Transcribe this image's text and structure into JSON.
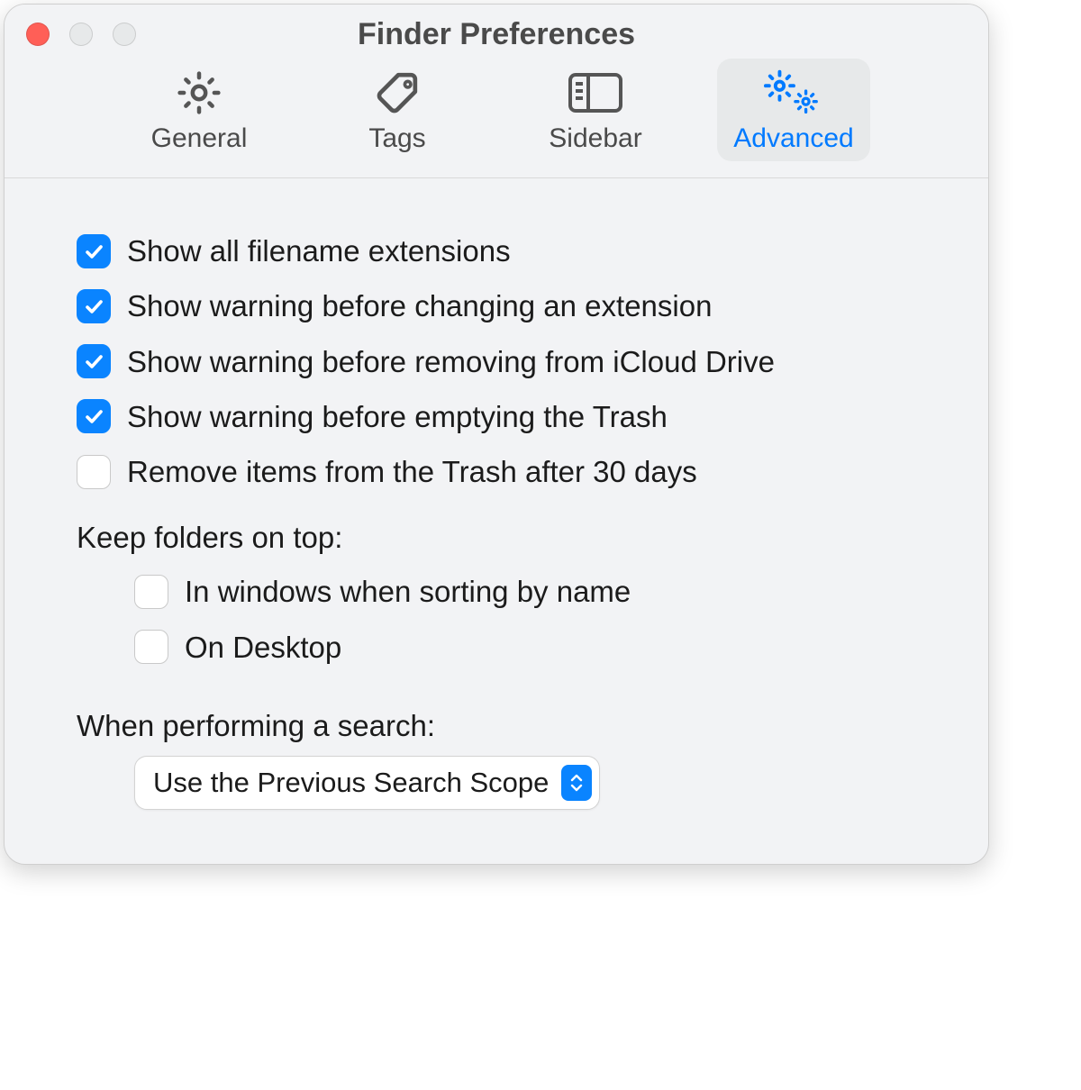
{
  "windowTitle": "Finder Preferences",
  "tabs": {
    "general": {
      "label": "General",
      "selected": false
    },
    "tags": {
      "label": "Tags",
      "selected": false
    },
    "sidebar": {
      "label": "Sidebar",
      "selected": false
    },
    "advanced": {
      "label": "Advanced",
      "selected": true
    }
  },
  "options": {
    "showExt": {
      "label": "Show all filename extensions",
      "checked": true
    },
    "warnExt": {
      "label": "Show warning before changing an extension",
      "checked": true
    },
    "warnICloud": {
      "label": "Show warning before removing from iCloud Drive",
      "checked": true
    },
    "warnTrash": {
      "label": "Show warning before emptying the Trash",
      "checked": true
    },
    "trash30": {
      "label": "Remove items from the Trash after 30 days",
      "checked": false
    },
    "keepTopLabel": "Keep folders on top:",
    "keepTopSortName": {
      "label": "In windows when sorting by name",
      "checked": false
    },
    "keepTopDesktop": {
      "label": "On Desktop",
      "checked": false
    },
    "searchLabel": "When performing a search:",
    "searchScope": "Use the Previous Search Scope"
  }
}
